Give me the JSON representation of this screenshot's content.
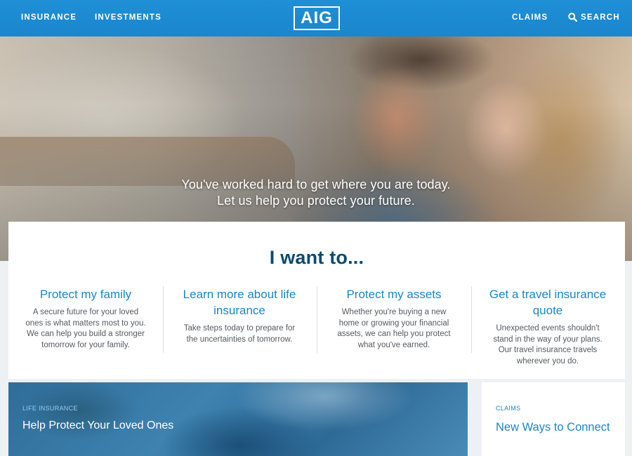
{
  "nav": {
    "insurance": "INSURANCE",
    "investments": "INVESTMENTS",
    "logo": "AIG",
    "claims": "CLAIMS",
    "search": "SEARCH"
  },
  "hero": {
    "line1": "You've worked hard to get where you are today.",
    "line2": "Let us help you protect your future."
  },
  "want": {
    "title": "I want to...",
    "options": [
      {
        "title": "Protect my family",
        "desc": "A secure future for your loved ones is what matters most to you. We can help you build a stronger tomorrow for your family."
      },
      {
        "title": "Learn more about life insurance",
        "desc": "Take steps today to prepare for the uncertainties of tomorrow."
      },
      {
        "title": "Protect my assets",
        "desc": "Whether you're buying a new home or growing your financial assets, we can help you protect what you've earned."
      },
      {
        "title": "Get a travel insurance quote",
        "desc": "Unexpected events shouldn't stand in the way of your plans. Our travel insurance travels wherever you do."
      }
    ]
  },
  "promo": {
    "label": "LIFE INSURANCE",
    "title": "Help Protect Your Loved Ones"
  },
  "claims_card": {
    "label": "CLAIMS",
    "title": "New Ways to Connect"
  },
  "colors": {
    "brand_blue": "#1a86cd",
    "heading_navy": "#0c4a6e"
  },
  "icons": {
    "search": "search-icon"
  }
}
